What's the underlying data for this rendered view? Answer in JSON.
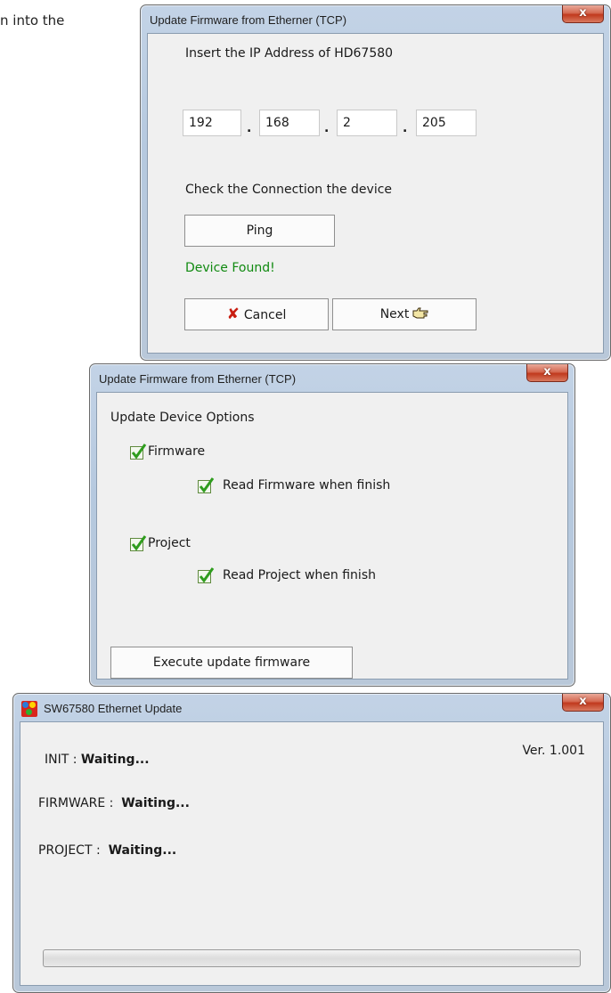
{
  "doc": {
    "fragment": "n into the"
  },
  "dialog1": {
    "title": "Update Firmware from Etherner (TCP)",
    "close_label": "x",
    "ip_prompt": "Insert the IP Address of HD67580",
    "ip": [
      "192",
      "168",
      "2",
      "205"
    ],
    "ip_separator": ".",
    "check_label": "Check the Connection the device",
    "ping_label": "Ping",
    "status": "Device Found!",
    "status_color": "#118a11",
    "cancel_label": "Cancel",
    "cancel_icon": "red-x-icon",
    "next_label": "Next",
    "next_icon": "pointing-hand-icon"
  },
  "dialog2": {
    "title": "Update Firmware from Etherner (TCP)",
    "close_label": "x",
    "section_label": "Update Device Options",
    "options": [
      {
        "label": "Firmware",
        "checked": true
      },
      {
        "label": "Read Firmware when finish",
        "checked": true
      },
      {
        "label": "Project",
        "checked": true
      },
      {
        "label": "Read Project when finish",
        "checked": true
      }
    ],
    "execute_label": "Execute update firmware"
  },
  "dialog3": {
    "title": "SW67580 Ethernet Update",
    "close_label": "x",
    "version": "Ver. 1.001",
    "rows": [
      {
        "label": "INIT :",
        "value": "Waiting..."
      },
      {
        "label": "FIRMWARE :",
        "value": "Waiting..."
      },
      {
        "label": "PROJECT :",
        "value": "Waiting..."
      }
    ],
    "progress": 0
  }
}
